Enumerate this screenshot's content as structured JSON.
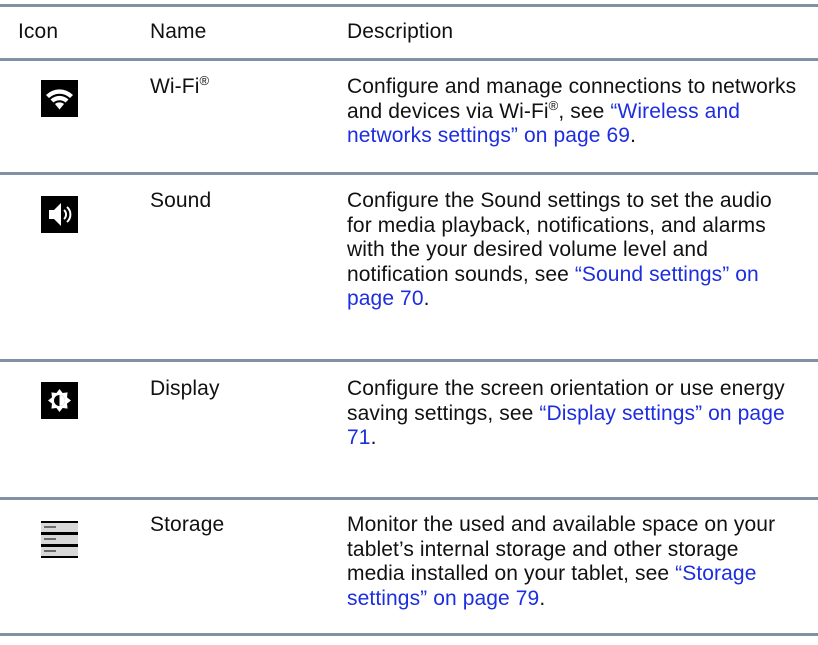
{
  "header": {
    "icon": "Icon",
    "name": "Name",
    "description": "Description"
  },
  "rows": [
    {
      "icon": "wifi-icon",
      "name": "Wi-Fi",
      "name_sup": "®",
      "desc_text": "Configure and manage connections to networks and devices via Wi-Fi",
      "desc_sup": "®",
      "desc_tail": ", see ",
      "link": "“Wireless and networks settings” on page 69",
      "end": "."
    },
    {
      "icon": "sound-icon",
      "name": "Sound",
      "desc_text": "Configure the Sound settings to set the audio for media playback, notifications, and alarms with the your desired volume level and notification sounds, see ",
      "link": "“Sound settings” on page 70",
      "end": "."
    },
    {
      "icon": "brightness-icon",
      "name": "Display",
      "desc_text": "Configure the screen orientation or use energy saving settings, see ",
      "link": "“Display settings” on page 71",
      "end": "."
    },
    {
      "icon": "storage-icon",
      "name": "Storage",
      "desc_text": "Monitor the used and available space on your tablet’s internal storage and other storage media installed on your tablet, see ",
      "link": "“Storage settings” on page 79",
      "end": "."
    }
  ],
  "colors": {
    "rule": "#7e92a3",
    "link": "#1d2de0",
    "text": "#111111",
    "icon_bg": "#000000"
  }
}
